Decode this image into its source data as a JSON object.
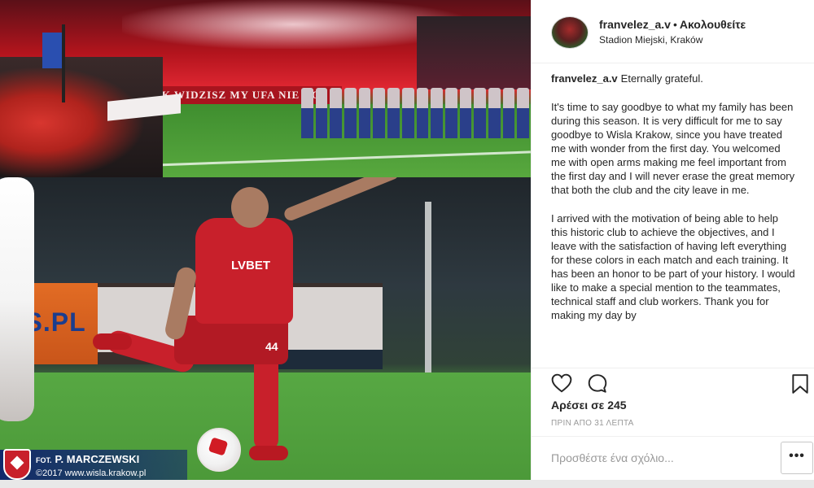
{
  "post": {
    "header": {
      "username": "franvelez_a.v",
      "separator": "•",
      "follow_label": "Ακολουθείτε",
      "location": "Stadion Miejski, Kraków"
    },
    "caption": {
      "username": "franvelez_a.v",
      "first_line": "Eternally grateful.",
      "paragraphs": [
        "It's time to say goodbye to what my family has been during this season. It is very difficult for me to say goodbye to Wisla Krakow, since you have treated me with wonder from the first day. You welcomed me with open arms making me feel important from the first day and I will never erase the great memory that both the club and the city leave in me.",
        "I arrived with the motivation of being able to help this historic club to achieve the objectives, and I leave with the satisfaction of having left everything for these colors in each match and each training. It has been an honor to be part of your history. I would like to make a special mention to the teammates, technical staff and club workers. Thank you for making my day by"
      ]
    },
    "likes_text": "Αρέσει σε 245",
    "time_text": "ΠΡΙΝ ΑΠΟ 31 ΛΕΠΤΑ",
    "comment_placeholder": "Προσθέστε ένα σχόλιο...",
    "more_label": "•••"
  },
  "photo": {
    "banner_text": "BO JAK WIDZISZ MY UFA NIE NO",
    "sponsor": "LVBET",
    "shirt_number": "44",
    "board_text": "TS.PL",
    "credit_fot": "FOT.",
    "credit_name": "P. MARCZEWSKI",
    "credit_url": "©2017 www.wisla.krakow.pl"
  },
  "icons": {
    "like": "heart-icon",
    "comment": "comment-icon",
    "save": "bookmark-icon"
  }
}
